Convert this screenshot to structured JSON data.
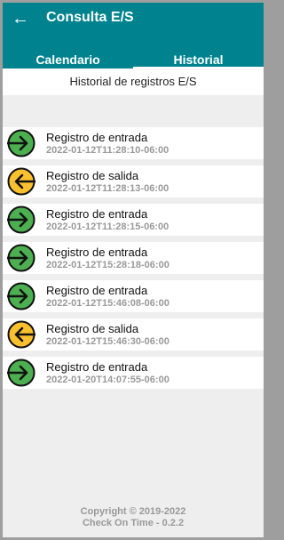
{
  "header": {
    "title": "Consulta E/S",
    "tabs": [
      {
        "label": "Calendario"
      },
      {
        "label": "Historial"
      }
    ]
  },
  "subheader": "Historial de registros E/S",
  "records": [
    {
      "label": "Registro de entrada",
      "time": "2022-01-12T11:28:10-06:00",
      "kind": "entrada"
    },
    {
      "label": "Registro de salida",
      "time": "2022-01-12T11:28:13-06:00",
      "kind": "salida"
    },
    {
      "label": "Registro de entrada",
      "time": "2022-01-12T11:28:15-06:00",
      "kind": "entrada"
    },
    {
      "label": "Registro de entrada",
      "time": "2022-01-12T15:28:18-06:00",
      "kind": "entrada"
    },
    {
      "label": "Registro de entrada",
      "time": "2022-01-12T15:46:08-06:00",
      "kind": "entrada"
    },
    {
      "label": "Registro de salida",
      "time": "2022-01-12T15:46:30-06:00",
      "kind": "salida"
    },
    {
      "label": "Registro de entrada",
      "time": "2022-01-20T14:07:55-06:00",
      "kind": "entrada"
    }
  ],
  "footer": {
    "copyright": "Copyright © 2019-2022",
    "version": "Check On Time - 0.2.2"
  },
  "colors": {
    "appbar": "#00838f",
    "entrada": "#4caf50",
    "salida": "#fbc02d"
  }
}
